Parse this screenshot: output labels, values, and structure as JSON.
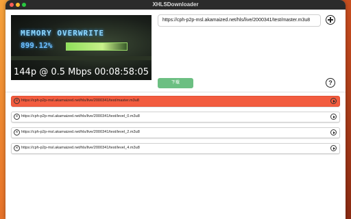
{
  "window": {
    "title": "XHLSDownloader"
  },
  "preview": {
    "overlay_big": "MEMORY OVERWRITE",
    "overlay_percent": "899.12%",
    "quality": "144p @ 0.5 Mbps",
    "time": "00:08:58:05"
  },
  "url_input": {
    "value": "https://cph-p2p-msl.akamaized.net/hls/live/2000341/test/master.m3u8"
  },
  "buttons": {
    "download": "下载",
    "help": "?"
  },
  "icons": {
    "add": "plus-circle-icon",
    "help": "question-circle-icon",
    "remove": "close-circle-icon",
    "play": "play-circle-icon"
  },
  "colors": {
    "active_row": "#f25c3f",
    "download_button": "#6cbf82"
  },
  "list": [
    {
      "url": "https://cph-p2p-msl.akamaized.net/hls/live/2000341/test/master.m3u8",
      "active": true
    },
    {
      "url": "https://cph-p2p-msl.akamaized.net/hls/live/2000341/test/level_0.m3u8",
      "active": false
    },
    {
      "url": "https://cph-p2p-msl.akamaized.net/hls/live/2000341/test/level_2.m3u8",
      "active": false
    },
    {
      "url": "https://cph-p2p-msl.akamaized.net/hls/live/2000341/test/level_4.m3u8",
      "active": false
    }
  ]
}
